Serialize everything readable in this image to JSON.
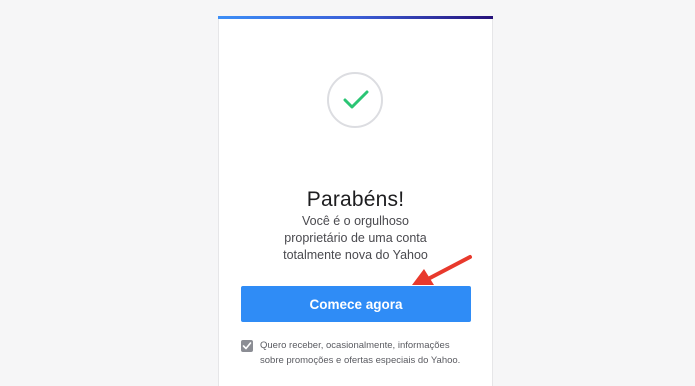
{
  "card": {
    "title": "Parabéns!",
    "subtitle_lines": [
      "Você é o orgulhoso",
      "proprietário de uma conta",
      "totalmente nova do Yahoo"
    ],
    "cta_label": "Comece agora",
    "optin": {
      "checked": true,
      "lines": [
        "Quero receber, ocasionalmente, informações",
        "sobre promoções e ofertas especiais do Yahoo."
      ]
    }
  },
  "icons": {
    "success": "checkmark-icon",
    "checkbox": "checkbox-check-icon",
    "annotation": "red-arrow-icon"
  },
  "colors": {
    "background": "#f6f6f7",
    "card": "#ffffff",
    "accent_gradient_start": "#3d8ff7",
    "accent_gradient_end": "#26117a",
    "check_green": "#2bc574",
    "button": "#2f8cf6",
    "annotation_arrow": "#e8392c"
  }
}
